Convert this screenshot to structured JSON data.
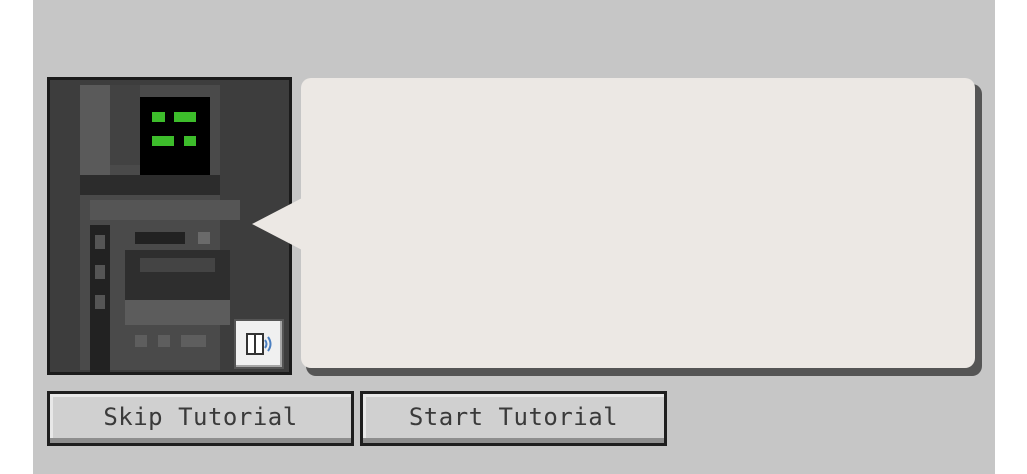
{
  "dialog": {
    "message": "",
    "tail_color": "#ece8e4",
    "bubble_color": "#ece8e4"
  },
  "npc": {
    "screen_color": "#000000",
    "face_color": "#3dbd2b",
    "text_to_speech_icon": "book-speaker-icon"
  },
  "buttons": {
    "skip_label": "Skip Tutorial",
    "start_label": "Start Tutorial"
  }
}
